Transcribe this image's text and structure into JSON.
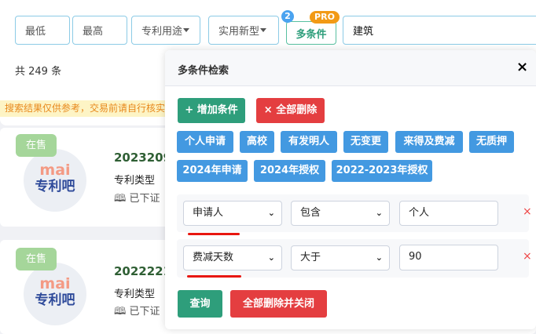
{
  "filters": {
    "min_placeholder": "最低",
    "max_placeholder": "最高",
    "usage": "专利用途",
    "type": "实用新型",
    "multi": "多条件",
    "multi_count": "2",
    "pro": "PRO",
    "search_value": "建筑"
  },
  "count_text": "共 249 条",
  "warning": "搜索结果仅供参考，交易前请自行核实",
  "cards": [
    {
      "tag": "在售",
      "logo_top": "mai",
      "logo_bottom": "专利吧",
      "number": "2023209",
      "type_label": "专利类型",
      "status": "已下证"
    },
    {
      "tag": "在售",
      "logo_top": "mai",
      "logo_bottom": "专利吧",
      "number": "2022221",
      "type_label": "专利类型",
      "status": "已下证"
    }
  ],
  "modal": {
    "title": "多条件检索",
    "close": "×",
    "add_label": "+ 增加条件",
    "delete_all_label": "× 全部删除",
    "chips": [
      "个人申请",
      "高校",
      "有发明人",
      "无变更",
      "来得及费减",
      "无质押",
      "2024年申请",
      "2024年授权",
      "2022-2023年授权"
    ],
    "conditions": [
      {
        "field": "申请人",
        "op": "包含",
        "value": "个人"
      },
      {
        "field": "费减天数",
        "op": "大于",
        "value": "90"
      }
    ],
    "query_label": "查询",
    "delete_close_label": "全部删除并关闭"
  },
  "colors": {
    "green": "#2e9e7b",
    "red": "#e43e40",
    "blue": "#4399e1",
    "annotation": "#e8160f"
  }
}
